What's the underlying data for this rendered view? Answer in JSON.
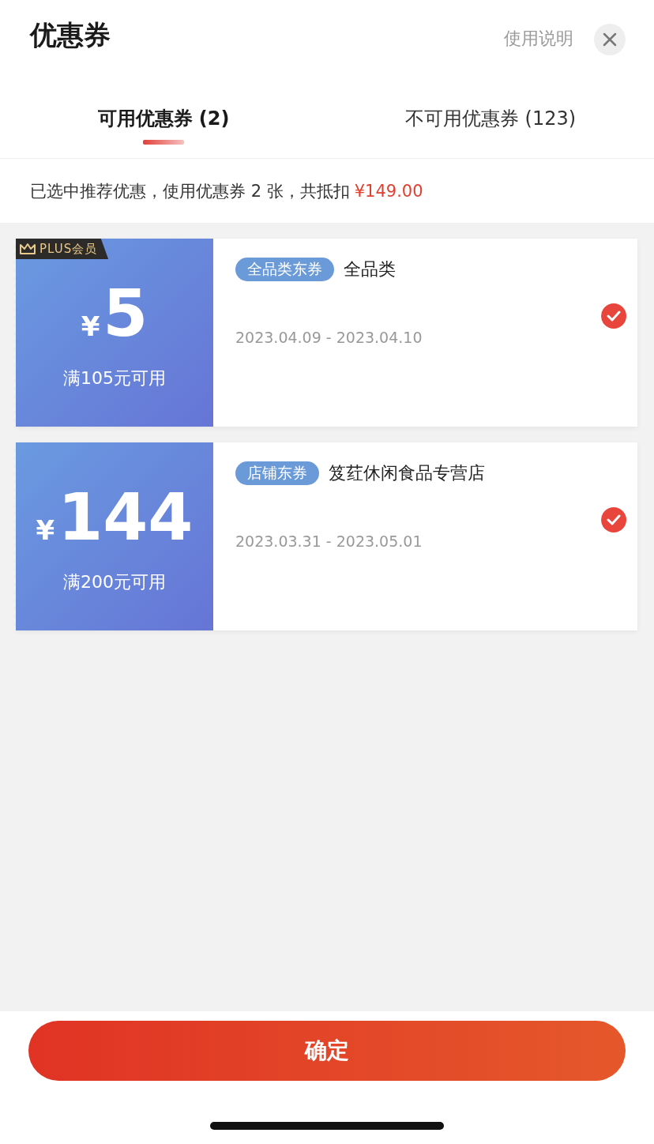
{
  "header": {
    "title": "优惠券",
    "help_link": "使用说明"
  },
  "tabs": [
    {
      "label": "可用优惠券 (2)",
      "selected": true
    },
    {
      "label": "不可用优惠券 (123)",
      "selected": false
    }
  ],
  "summary": {
    "text": "已选中推荐优惠，使用优惠券 2 张，共抵扣",
    "amount": "¥149.00"
  },
  "coupons": [
    {
      "badge": "PLUS会员",
      "currency": "¥",
      "amount": "5",
      "condition": "满105元可用",
      "tag": "全品类东券",
      "scope": "全品类",
      "validity": "2023.04.09 - 2023.04.10",
      "selected": true
    },
    {
      "currency": "¥",
      "amount": "144",
      "condition": "满200元可用",
      "tag": "店铺东券",
      "scope": "笈荭休闲食品专营店",
      "validity": "2023.03.31 - 2023.05.01",
      "selected": true
    }
  ],
  "confirm_button": "确定"
}
